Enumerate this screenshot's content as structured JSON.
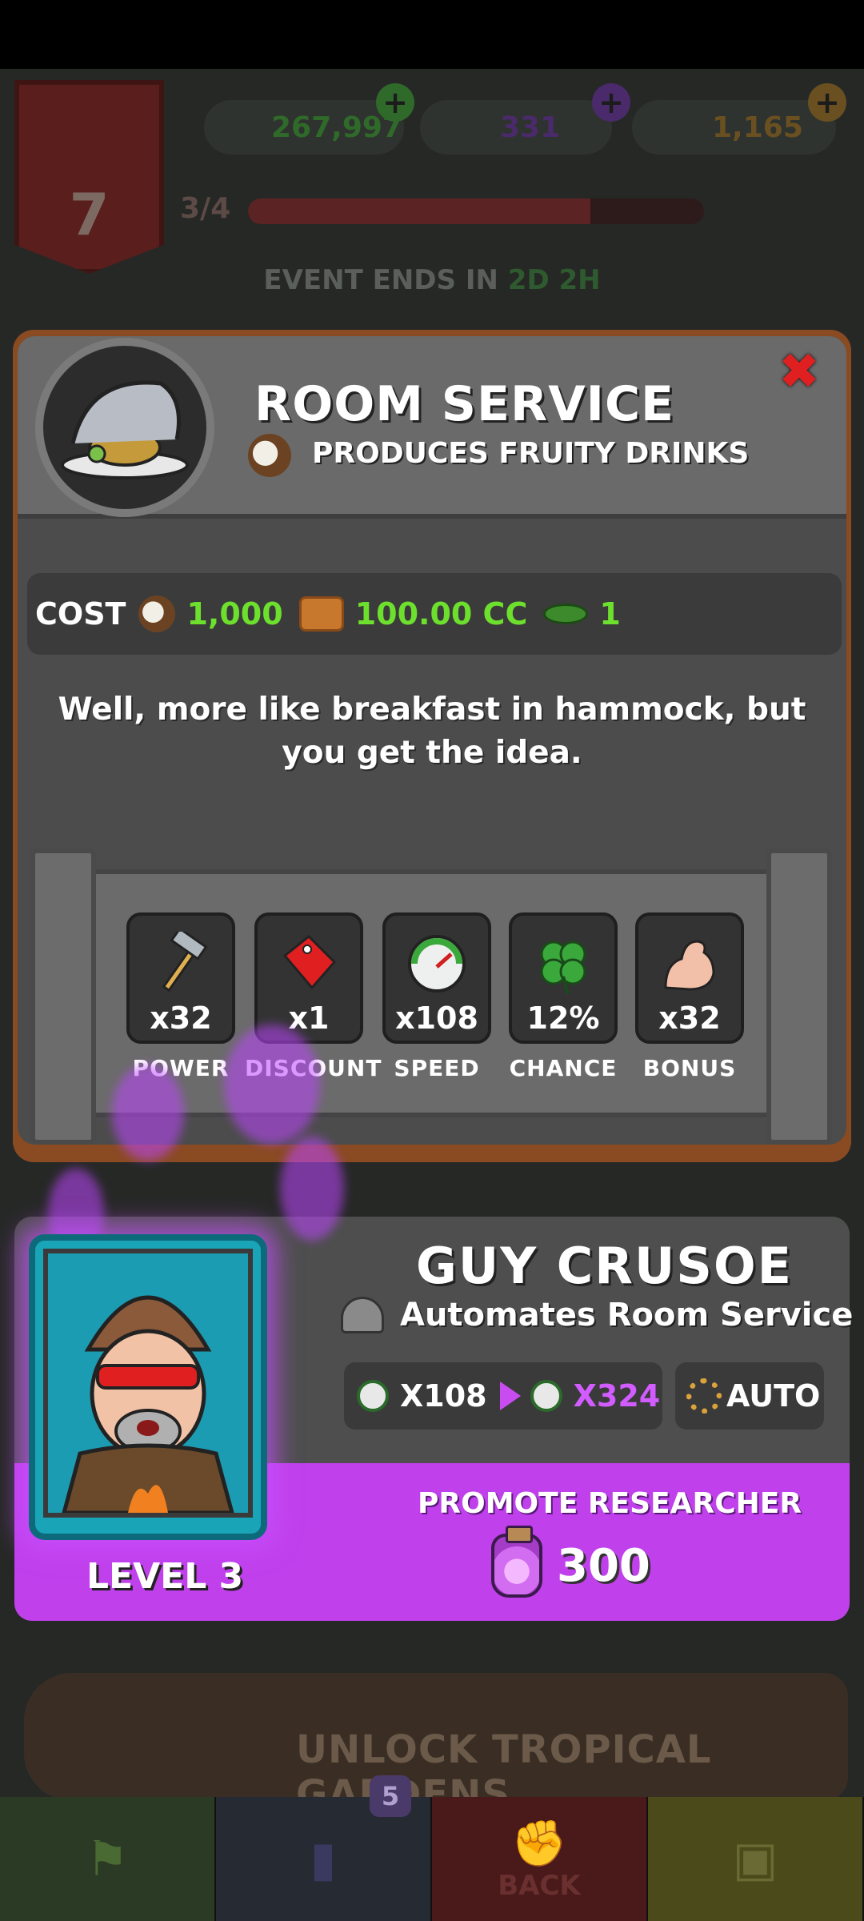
{
  "hud": {
    "stage_level": "7",
    "currencies": [
      {
        "name": "cash",
        "value": "267,997",
        "color": "#2f8a2a"
      },
      {
        "name": "potion",
        "value": "331",
        "color": "#6b3a8a"
      },
      {
        "name": "gold",
        "value": "1,165",
        "color": "#8a6a20"
      }
    ],
    "progress_label": "3/4",
    "progress_fraction": 0.75,
    "event_label": "EVENT ENDS IN",
    "event_time": "2D 2H"
  },
  "modal": {
    "title": "ROOM SERVICE",
    "subtitle": "PRODUCES FRUITY DRINKS",
    "close_icon": "close-icon",
    "cost": {
      "label": "COST",
      "items": [
        {
          "icon": "coconut-drink-icon",
          "value": "1,000"
        },
        {
          "icon": "suitcase-icon",
          "value": "100.00 CC"
        },
        {
          "icon": "leaf-icon",
          "value": "1"
        }
      ]
    },
    "description": "Well, more like breakfast in hammock, but you get the idea.",
    "stats": [
      {
        "icon": "hammer-icon",
        "value": "x32",
        "label": "POWER"
      },
      {
        "icon": "price-tag-icon",
        "value": "x1",
        "label": "DISCOUNT"
      },
      {
        "icon": "speed-gauge-icon",
        "value": "x108",
        "label": "SPEED"
      },
      {
        "icon": "clover-icon",
        "value": "12%",
        "label": "CHANCE"
      },
      {
        "icon": "muscle-arm-icon",
        "value": "x32",
        "label": "BONUS"
      }
    ]
  },
  "researcher": {
    "name": "GUY CRUSOE",
    "automates": "Automates Room Service",
    "speed_from": "X108",
    "speed_to": "X324",
    "auto_label": "AUTO",
    "level": "LEVEL 3",
    "promote_label": "PROMOTE RESEARCHER",
    "promote_cost": "300",
    "accent_color": "#c040ec"
  },
  "background": {
    "unlock_text": "UNLOCK TROPICAL GARDENS",
    "nav_badge": "5",
    "back_label": "BACK"
  }
}
